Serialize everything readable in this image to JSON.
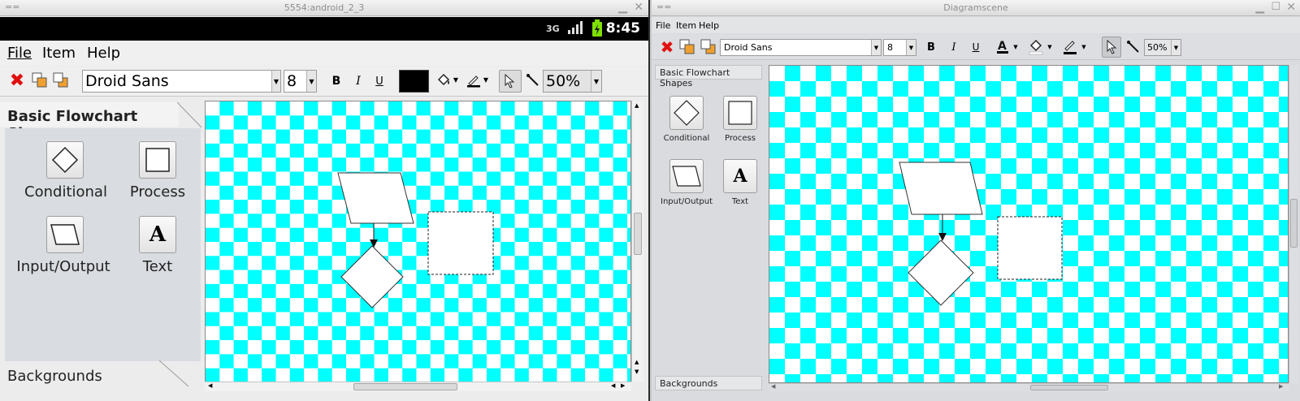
{
  "left_window": {
    "title": "5554:android_2_3",
    "grip": "==",
    "status_icons": [
      "3G",
      "signal-icon",
      "battery-icon"
    ],
    "clock": "8:45",
    "menu": [
      "File",
      "Item",
      "Help"
    ],
    "font_combo": "Droid Sans",
    "size_combo": "8",
    "zoom_combo": "50%",
    "bold": "B",
    "italic": "I",
    "underline": "U",
    "panel_title": "Basic Flowchart Shapes",
    "shapes": [
      "Conditional",
      "Process",
      "Input/Output",
      "Text"
    ],
    "text_glyph": "A",
    "bottom_tab": "Backgrounds",
    "fill_color": "#000000"
  },
  "right_window": {
    "title": "Diagramscene",
    "grip": "==",
    "menu": [
      "File",
      "Item",
      "Help"
    ],
    "font_combo": "Droid Sans",
    "size_combo": "8",
    "zoom_combo": "50%",
    "bold": "B",
    "italic": "I",
    "underline": "U",
    "panel_title": "Basic Flowchart Shapes",
    "shapes": [
      "Conditional",
      "Process",
      "Input/Output",
      "Text"
    ],
    "text_glyph": "A",
    "bottom_tab": "Backgrounds"
  },
  "colors": {
    "checker_a": "#00ffff",
    "checker_b": "#ffffff",
    "delete_red": "#e01010"
  }
}
